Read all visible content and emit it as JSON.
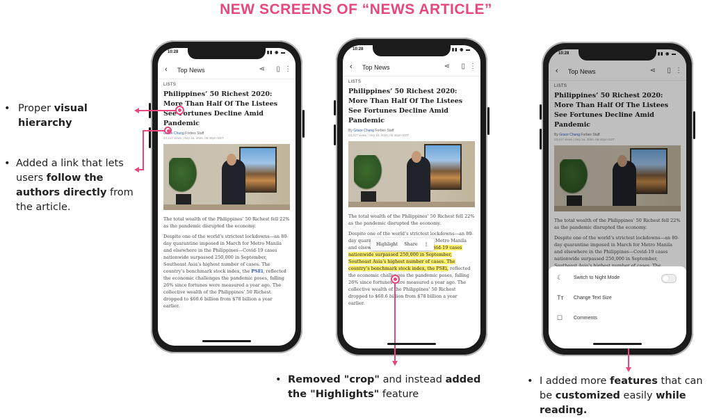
{
  "title": "NEW SCREENS OF “NEWS ARTICLE”",
  "accent_color": "#e8477e",
  "notes": {
    "n1": {
      "pre": "Proper ",
      "bold": "visual hierarchy"
    },
    "n2": {
      "pre": "Added a link that lets users ",
      "bold": "follow the authors directly",
      "post": " from the article."
    },
    "n3": {
      "pre": "Removed \"crop\"",
      "mid": " and instead ",
      "bold2": "added the \"Highlights\"",
      "post": " feature"
    },
    "n4": {
      "pre": "I added more ",
      "bold": "features",
      "mid": " that can be ",
      "bold2": "customized",
      "mid2": " easily ",
      "bold3": "while reading."
    }
  },
  "phone": {
    "time": "10:28",
    "nav_title": "Top News",
    "icons": {
      "back": "back-arrow-icon",
      "share": "share-icon",
      "bookmark": "bookmark-icon",
      "more": "more-vertical-icon"
    },
    "section": "LISTS",
    "headline": "Philippines’ 50 Richest 2020: More Than Half Of The Listees See Fortunes Decline Amid Pandemic",
    "by": "By",
    "author": "Grace Chung",
    "author_role": "Forbes Staff",
    "meta": "23,217 views | Sep 16, 2020, 05:40pm EDT",
    "para1": "The total wealth of the Philippines’ 50 Richest fell 22% as the pandemic disrupted the economy.",
    "para2a": "Despite one of the world’s strictest lockdowns—an 80-day quarantine imposed in March for Metro Manila and elsewhere in the Philippines—Covid-19 cases nationwide surpassed 250,000 in September, Southeast Asia’s highest number of cases. The country’s benchmark stock index, the ",
    "link": "PSEi",
    "para2b": ", reflected the economic challenges the pandemic poses, falling 26% since fortunes were measured a year ago. The collective wealth of the Philippines’ 50 Richest dropped to $60.6 billion from $78 billion a year earlier.",
    "p2_pre": "Despite one of the world’s strictest lockdowns—an 80-day quarantine imposed in March for Metro Manila and elsewhere in the ",
    "p2_hl": "Philippines—Covid-19 cases nationwide surpassed 250,000 in September, Southeast Asia’s highest number of cases. The country’s benchmark stock index, the PSEi,",
    "p2_post": " reflected the economic challenges the pandemic poses, falling 26% since fortunes were measured a year ago. The collective wealth of the Philippines’ 50 Richest dropped to $60.6 billion from $78 billion a year earlier.",
    "popup": {
      "highlight": "Highlight",
      "share": "Share"
    },
    "sheet": [
      {
        "icon": "moon-icon",
        "glyph": "☾",
        "label": "Switch to Night Mode"
      },
      {
        "icon": "text-size-icon",
        "glyph": "Tт",
        "label": "Change Text Size"
      },
      {
        "icon": "comments-icon",
        "glyph": "☐",
        "label": "Comments"
      }
    ]
  }
}
